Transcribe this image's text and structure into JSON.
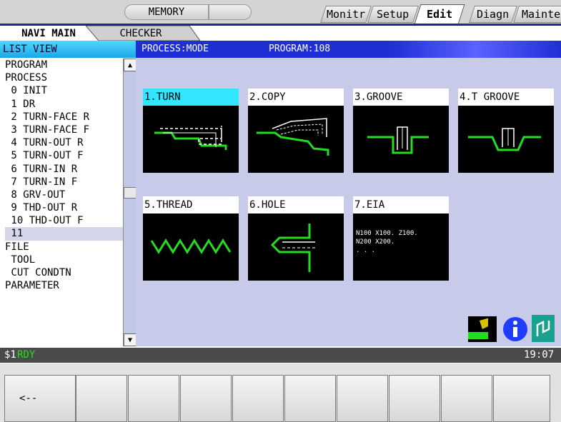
{
  "top": {
    "mode_label": "MEMORY",
    "tabs": [
      "Monitr",
      "Setup",
      "Edit",
      "Diagn",
      "Mainte"
    ],
    "active_tab": "Edit"
  },
  "subtabs": [
    "NAVI MAIN",
    "CHECKER"
  ],
  "list_view": {
    "title": "LIST VIEW",
    "items": [
      "PROGRAM",
      "PROCESS",
      " 0 INIT",
      " 1 DR",
      " 2 TURN-FACE R",
      " 3 TURN-FACE F",
      " 4 TURN-OUT R",
      " 5 TURN-OUT F",
      " 6 TURN-IN R",
      " 7 TURN-IN F",
      " 8 GRV-OUT",
      " 9 THD-OUT R",
      " 10 THD-OUT F",
      " 11",
      "FILE",
      " TOOL",
      " CUT CONDTN",
      "PARAMETER"
    ],
    "selected_index": 13
  },
  "process_header": {
    "mode": "PROCESS:MODE",
    "program": "PROGRAM:108"
  },
  "processes": [
    {
      "label": "1.TURN"
    },
    {
      "label": "2.COPY"
    },
    {
      "label": "3.GROOVE"
    },
    {
      "label": "4.T GROOVE"
    },
    {
      "label": "5.THREAD"
    },
    {
      "label": "6.HOLE"
    },
    {
      "label": "7.EIA",
      "code_lines": [
        "N100 X100. Z100.",
        "N200 X200.",
        ". . ."
      ]
    }
  ],
  "highlighted_process": "1.TURN",
  "status": {
    "system": "$1",
    "state": "RDY",
    "time": "19:07"
  },
  "fkeys": [
    "<--",
    "",
    "",
    "",
    "",
    "",
    "",
    "",
    "",
    ""
  ],
  "colors": {
    "accent_blue": "#1f2fd6",
    "highlight_cyan": "#33e6ff",
    "path_green": "#22dd22",
    "rdy_green": "#22dd22"
  }
}
